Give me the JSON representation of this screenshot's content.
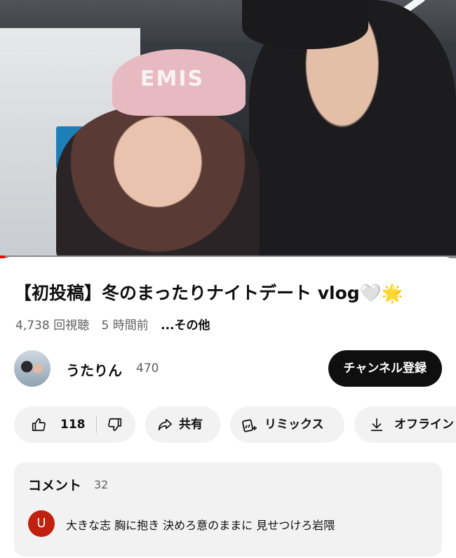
{
  "video": {
    "cap_text": "EMIS",
    "progress_fraction": 0.01,
    "accent_color": "#ff0000"
  },
  "details": {
    "title": "【初投稿】冬のまったりナイトデート vlog🤍🌟",
    "views": "4,738 回視聴",
    "time_ago": "5 時間前",
    "more": "...その他"
  },
  "channel": {
    "name": "うたりん",
    "subscribers": "470",
    "subscribe_label": "チャンネル登録"
  },
  "actions": {
    "like_count": "118",
    "share_label": "共有",
    "remix_label": "リミックス",
    "offline_label": "オフライン",
    "icons": [
      "thumbs-up-icon",
      "thumbs-down-icon",
      "share-icon",
      "remix-icon",
      "download-icon"
    ]
  },
  "comments": {
    "heading": "コメント",
    "count": "32",
    "top_comment": {
      "avatar_letter": "U",
      "avatar_color": "#c0200e",
      "text": "大きな志 胸に抱き 決めろ意のままに 見せつけろ岩隈"
    }
  }
}
